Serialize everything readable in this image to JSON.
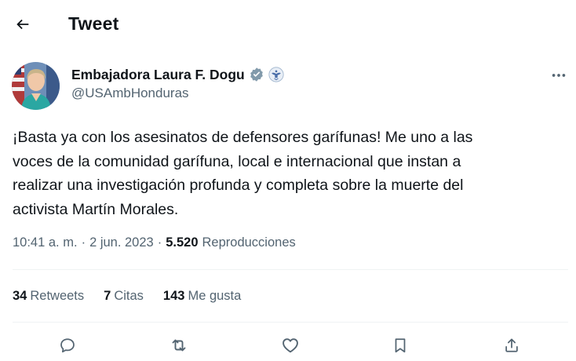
{
  "header": {
    "title": "Tweet",
    "back_icon": "arrow-left-icon"
  },
  "author": {
    "name": "Embajadora Laura F. Dogu",
    "handle": "@USAmbHonduras",
    "verified_badge": "verified-gray-badge-icon",
    "affiliation_badge": "us-state-department-seal-icon"
  },
  "menu": {
    "more_icon": "more-horizontal-icon"
  },
  "tweet": {
    "text": "¡Basta ya con los asesinatos de defensores garífunas! Me uno a las\nvoces de la comunidad garífuna, local e internacional que instan a\nrealizar una investigación profunda y completa sobre la muerte del\nactivista Martín Morales."
  },
  "meta": {
    "time": "10:41 a. m.",
    "separator": "·",
    "date": "2 jun. 2023",
    "views_count": "5.520",
    "views_label": "Reproducciones"
  },
  "stats": {
    "retweets_count": "34",
    "retweets_label": "Retweets",
    "quotes_count": "7",
    "quotes_label": "Citas",
    "likes_count": "143",
    "likes_label": "Me gusta"
  },
  "actions": [
    "reply-icon",
    "retweet-icon",
    "like-icon",
    "bookmark-icon",
    "share-icon"
  ],
  "colors": {
    "text": "#0f1419",
    "secondary": "#536471",
    "divider": "#eff3f4",
    "icon": "#536471"
  }
}
